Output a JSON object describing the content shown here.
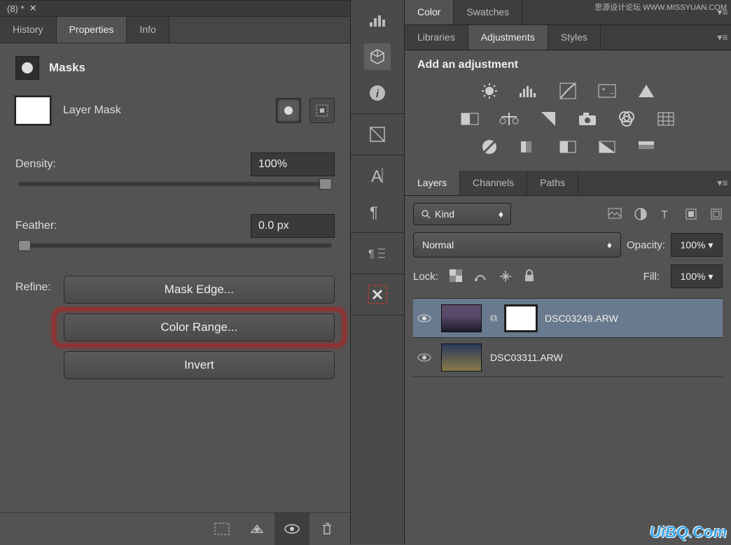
{
  "docTab": "(8) *",
  "tabs": {
    "history": "History",
    "properties": "Properties",
    "info": "Info"
  },
  "masks": {
    "title": "Masks",
    "layer_mask_label": "Layer Mask",
    "density_label": "Density:",
    "density_value": "100%",
    "feather_label": "Feather:",
    "feather_value": "0.0 px",
    "refine_label": "Refine:",
    "mask_edge": "Mask Edge...",
    "color_range": "Color Range...",
    "invert": "Invert"
  },
  "color_tabs": {
    "color": "Color",
    "swatches": "Swatches"
  },
  "adj_tabs": {
    "libraries": "Libraries",
    "adjustments": "Adjustments",
    "styles": "Styles"
  },
  "adjustments": {
    "title": "Add an adjustment",
    "row1": [
      "brightness-contrast",
      "levels",
      "curves",
      "exposure",
      "vibrance"
    ],
    "row2": [
      "hue-saturation",
      "color-balance",
      "black-white",
      "photo-filter",
      "channel-mixer",
      "color-lookup"
    ],
    "row3": [
      "invert",
      "posterize",
      "threshold",
      "gradient-map",
      "selective-color"
    ]
  },
  "layer_tabs": {
    "layers": "Layers",
    "channels": "Channels",
    "paths": "Paths"
  },
  "layers": {
    "kind_label": "Kind",
    "blend_mode": "Normal",
    "opacity_label": "Opacity:",
    "opacity_value": "100%",
    "lock_label": "Lock:",
    "fill_label": "Fill:",
    "fill_value": "100%",
    "items": [
      {
        "name": "DSC03249.ARW",
        "has_mask": true,
        "selected": true
      },
      {
        "name": "DSC03311.ARW",
        "has_mask": false,
        "selected": false
      }
    ]
  },
  "watermark": "UiBQ.Com",
  "watermark2": "思源设计论坛  WWW.MISSYUAN.COM"
}
